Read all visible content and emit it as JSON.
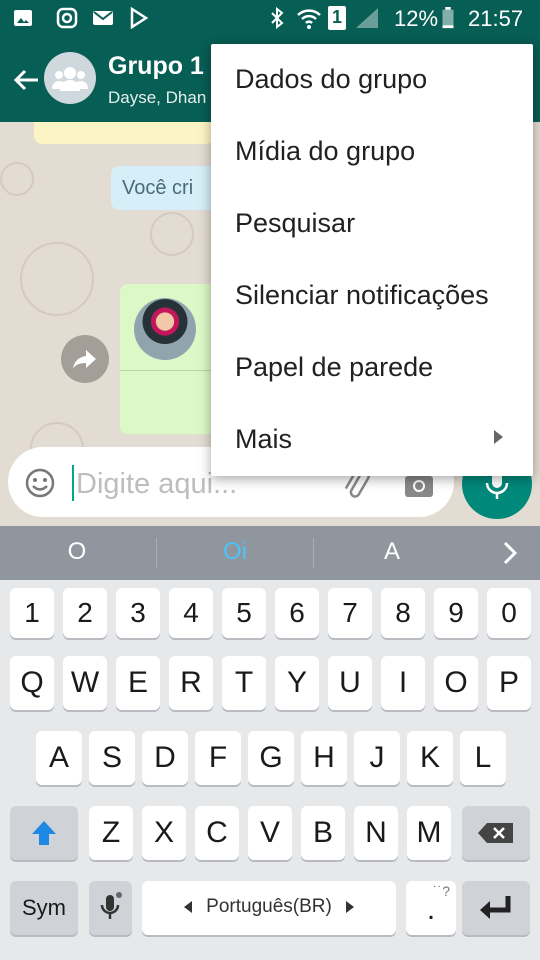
{
  "status_bar": {
    "battery_percent": "12%",
    "time": "21:57",
    "sim_label": "1",
    "icons": [
      "gallery-icon",
      "instagram-icon",
      "mail-icon",
      "play-store-icon",
      "bluetooth-icon",
      "wifi-icon",
      "sim-icon",
      "signal-icon",
      "battery-icon"
    ]
  },
  "header": {
    "title": "Grupo 1",
    "subtitle": "Dayse, Dhan",
    "avatar": "group-icon"
  },
  "chat": {
    "system_message": "Você cri"
  },
  "composer": {
    "placeholder": "Digite aqui...",
    "accent": "#00897b"
  },
  "menu": {
    "items": [
      {
        "label": "Dados do grupo"
      },
      {
        "label": "Mídia do grupo"
      },
      {
        "label": "Pesquisar"
      },
      {
        "label": "Silenciar notificações"
      },
      {
        "label": "Papel de parede"
      },
      {
        "label": "Mais",
        "has_submenu": true
      }
    ]
  },
  "keyboard": {
    "suggestions": [
      "O",
      "Oi",
      "A"
    ],
    "number_row": [
      "1",
      "2",
      "3",
      "4",
      "5",
      "6",
      "7",
      "8",
      "9",
      "0"
    ],
    "row1": [
      "Q",
      "W",
      "E",
      "R",
      "T",
      "Y",
      "U",
      "I",
      "O",
      "P"
    ],
    "row2": [
      "A",
      "S",
      "D",
      "F",
      "G",
      "H",
      "J",
      "K",
      "L"
    ],
    "row3": [
      "Z",
      "X",
      "C",
      "V",
      "B",
      "N",
      "M"
    ],
    "sym_label": "Sym",
    "language": "Português(BR)",
    "period": ".",
    "punct_hint": "˙˙?"
  },
  "colors": {
    "header": "#075e54",
    "bubble": "#dcf8c6",
    "highlight_suggestion": "#4fc3f7"
  }
}
